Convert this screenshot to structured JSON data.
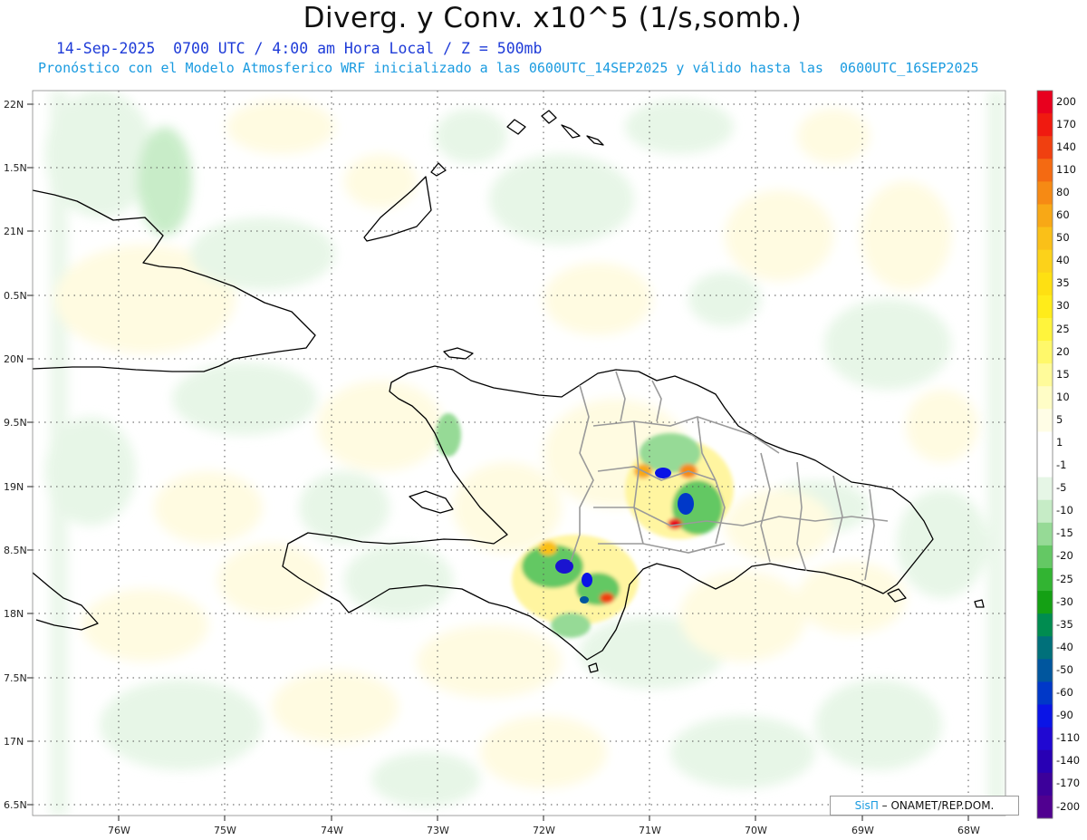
{
  "header": {
    "title": "Diverg. y Conv. x10^5 (1/s,somb.)",
    "subtitle_time": "14-Sep-2025  0700 UTC / 4:00 am Hora Local / Z = 500mb",
    "subtitle_model": "Pronóstico con el Modelo Atmosferico WRF inicializado a las 0600UTC_14SEP2025 y válido hasta las  0600UTC_16SEP2025"
  },
  "map": {
    "lat_labels": [
      "22N",
      "1.5N",
      "21N",
      "0.5N",
      "20N",
      "9.5N",
      "19N",
      "8.5N",
      "18N",
      "7.5N",
      "17N",
      "6.5N"
    ],
    "lon_labels": [
      "76W",
      "75W",
      "74W",
      "73W",
      "72W",
      "71W",
      "70W",
      "69W",
      "68W"
    ],
    "lat_range": [
      16.5,
      22.0
    ],
    "lon_range": [
      -76.6,
      -67.6
    ],
    "grid": true,
    "region": "Hispaniola (Haiti / Rep. Dominicana), Cuba oriental, Bahamas"
  },
  "colorbar": {
    "labels": [
      "200",
      "170",
      "140",
      "110",
      "80",
      "60",
      "50",
      "40",
      "35",
      "30",
      "25",
      "20",
      "15",
      "10",
      "5",
      "1",
      "-1",
      "-5",
      "-10",
      "-15",
      "-20",
      "-25",
      "-30",
      "-35",
      "-40",
      "-50",
      "-60",
      "-90",
      "-110",
      "-140",
      "-170",
      "-200"
    ],
    "colors": [
      "#e8001e",
      "#f01a10",
      "#f04010",
      "#f46a12",
      "#f68a14",
      "#f8a816",
      "#fac018",
      "#fcd21a",
      "#fee012",
      "#ffec1a",
      "#fff43c",
      "#fff86a",
      "#fffb9a",
      "#fffdc6",
      "#fffde6",
      "#ffffff",
      "#ffffff",
      "#e6f6e6",
      "#c6ecc6",
      "#96da96",
      "#64c864",
      "#32b432",
      "#14a014",
      "#008c50",
      "#00707a",
      "#00569e",
      "#0038c8",
      "#0a14e6",
      "#2008d2",
      "#2800b4",
      "#3c009a",
      "#500090"
    ]
  },
  "credit": {
    "brand": "SisΠ",
    "text": " – ONAMET/REP.DOM."
  }
}
